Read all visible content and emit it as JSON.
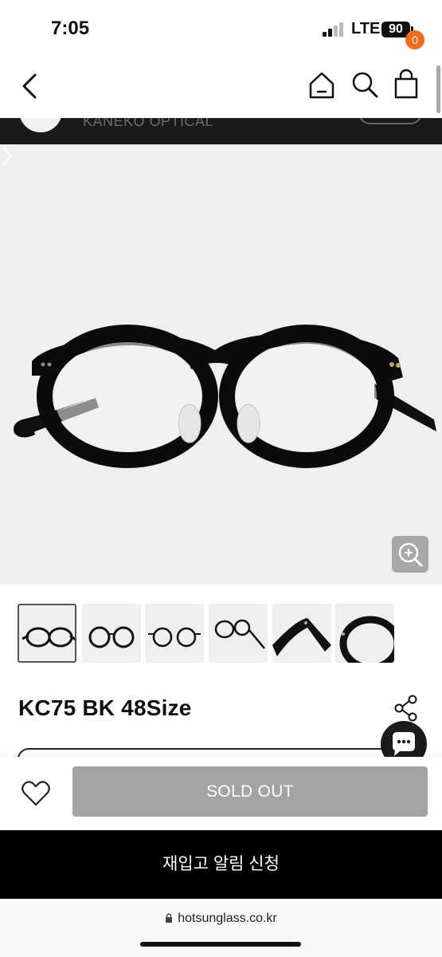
{
  "status": {
    "time": "7:05",
    "network": "LTE",
    "battery": "90"
  },
  "header": {
    "cart_count": "0",
    "icons": [
      "back-icon",
      "home-icon",
      "search-icon",
      "bag-icon"
    ]
  },
  "brand": {
    "name": "KANEKO OPTICAL"
  },
  "product": {
    "title": "KC75 BK 48Size",
    "sold_out_label": "SOLD OUT",
    "restock_label": "재입고 알림 신청"
  },
  "gallery": {
    "thumbnail_count": 6
  },
  "browser": {
    "url": "hotsunglass.co.kr"
  },
  "colors": {
    "accent_badge": "#f26a1b",
    "sold_out_bg": "#a3a3a3",
    "restock_bg": "#000000",
    "brand_bar": "#1a1a1a"
  }
}
